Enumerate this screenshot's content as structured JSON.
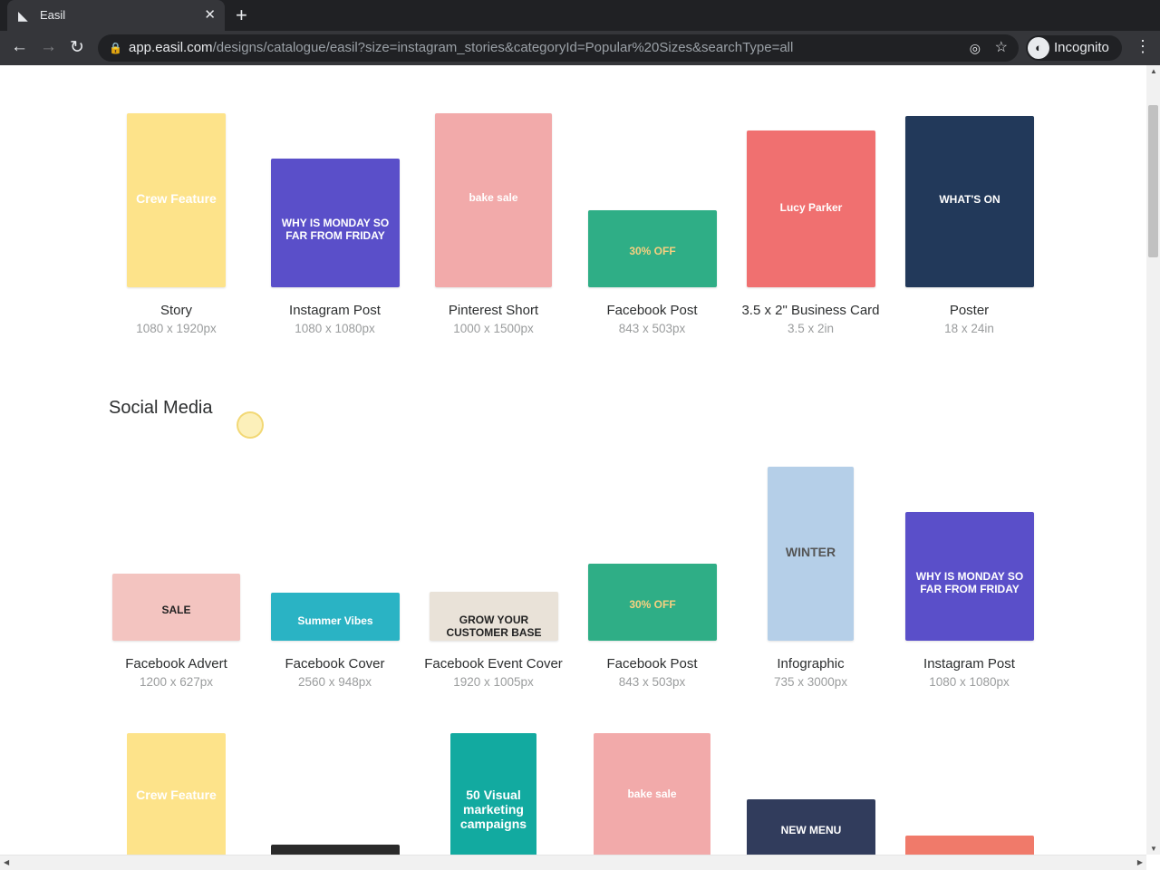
{
  "browser": {
    "tab_title": "Easil",
    "url_host": "app.easil.com",
    "url_path": "/designs/catalogue/easil?size=instagram_stories&categoryId=Popular%20Sizes&searchType=all",
    "incognito_label": "Incognito"
  },
  "sections": [
    {
      "title": "",
      "items": [
        {
          "label": "Story",
          "size": "1080 x 1920px",
          "thumb_text": "Crew Feature"
        },
        {
          "label": "Instagram Post",
          "size": "1080 x 1080px",
          "thumb_text": "WHY IS MONDAY SO FAR FROM FRIDAY"
        },
        {
          "label": "Pinterest Short",
          "size": "1000 x 1500px",
          "thumb_text": "bake sale"
        },
        {
          "label": "Facebook Post",
          "size": "843 x 503px",
          "thumb_text": "30% OFF"
        },
        {
          "label": "3.5 x 2\" Business Card",
          "size": "3.5 x 2in",
          "thumb_text": "Lucy Parker"
        },
        {
          "label": "Poster",
          "size": "18 x 24in",
          "thumb_text": "WHAT'S ON"
        }
      ]
    },
    {
      "title": "Social Media",
      "items": [
        {
          "label": "Facebook Advert",
          "size": "1200 x 627px",
          "thumb_text": "SALE"
        },
        {
          "label": "Facebook Cover",
          "size": "2560 x 948px",
          "thumb_text": "Summer Vibes"
        },
        {
          "label": "Facebook Event Cover",
          "size": "1920 x 1005px",
          "thumb_text": "GROW YOUR CUSTOMER BASE"
        },
        {
          "label": "Facebook Post",
          "size": "843 x 503px",
          "thumb_text": "30% OFF"
        },
        {
          "label": "Infographic",
          "size": "735 x 3000px",
          "thumb_text": "WINTER"
        },
        {
          "label": "Instagram Post",
          "size": "1080 x 1080px",
          "thumb_text": "WHY IS MONDAY SO FAR FROM FRIDAY"
        }
      ]
    },
    {
      "title": "",
      "items": [
        {
          "thumb_text": "Crew Feature"
        },
        {
          "thumb_text": ""
        },
        {
          "thumb_text": "50 Visual marketing campaigns"
        },
        {
          "thumb_text": "bake sale"
        },
        {
          "thumb_text": "NEW MENU"
        },
        {
          "thumb_text": ""
        }
      ]
    }
  ]
}
